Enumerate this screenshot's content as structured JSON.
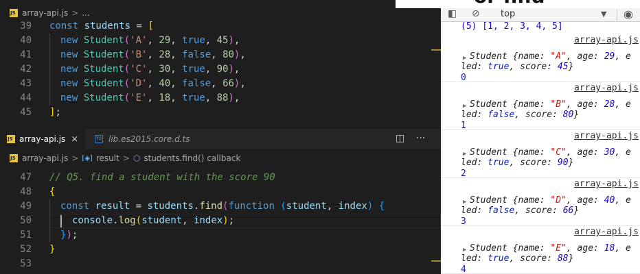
{
  "editor": {
    "top_breadcrumb": {
      "file": "array-api.js",
      "rest": "..."
    },
    "top_lines": [
      {
        "n": "39",
        "t": [
          [
            "kw",
            "const "
          ],
          [
            "var",
            "students"
          ],
          [
            "pl",
            " = "
          ],
          [
            "br1",
            "["
          ]
        ]
      },
      {
        "n": "40",
        "t": [
          [
            "kw",
            "new "
          ],
          [
            "cls",
            "Student"
          ],
          [
            "br2",
            "("
          ],
          [
            "str",
            "'A'"
          ],
          [
            "pl",
            ", "
          ],
          [
            "num",
            "29"
          ],
          [
            "pl",
            ", "
          ],
          [
            "kw",
            "true"
          ],
          [
            "pl",
            ", "
          ],
          [
            "num",
            "45"
          ],
          [
            "br2",
            ")"
          ],
          [
            "pl",
            ","
          ]
        ]
      },
      {
        "n": "41",
        "t": [
          [
            "kw",
            "new "
          ],
          [
            "cls",
            "Student"
          ],
          [
            "br2",
            "("
          ],
          [
            "str",
            "'B'"
          ],
          [
            "pl",
            ", "
          ],
          [
            "num",
            "28"
          ],
          [
            "pl",
            ", "
          ],
          [
            "kw",
            "false"
          ],
          [
            "pl",
            ", "
          ],
          [
            "num",
            "80"
          ],
          [
            "br2",
            ")"
          ],
          [
            "pl",
            ","
          ]
        ]
      },
      {
        "n": "42",
        "t": [
          [
            "kw",
            "new "
          ],
          [
            "cls",
            "Student"
          ],
          [
            "br2",
            "("
          ],
          [
            "str",
            "'C'"
          ],
          [
            "pl",
            ", "
          ],
          [
            "num",
            "30"
          ],
          [
            "pl",
            ", "
          ],
          [
            "kw",
            "true"
          ],
          [
            "pl",
            ", "
          ],
          [
            "num",
            "90"
          ],
          [
            "br2",
            ")"
          ],
          [
            "pl",
            ","
          ]
        ]
      },
      {
        "n": "43",
        "t": [
          [
            "kw",
            "new "
          ],
          [
            "cls",
            "Student"
          ],
          [
            "br2",
            "("
          ],
          [
            "str",
            "'D'"
          ],
          [
            "pl",
            ", "
          ],
          [
            "num",
            "40"
          ],
          [
            "pl",
            ", "
          ],
          [
            "kw",
            "false"
          ],
          [
            "pl",
            ", "
          ],
          [
            "num",
            "66"
          ],
          [
            "br2",
            ")"
          ],
          [
            "pl",
            ","
          ]
        ]
      },
      {
        "n": "44",
        "t": [
          [
            "kw",
            "new "
          ],
          [
            "cls",
            "Student"
          ],
          [
            "br2",
            "("
          ],
          [
            "str",
            "'E'"
          ],
          [
            "pl",
            ", "
          ],
          [
            "num",
            "18"
          ],
          [
            "pl",
            ", "
          ],
          [
            "kw",
            "true"
          ],
          [
            "pl",
            ", "
          ],
          [
            "num",
            "88"
          ],
          [
            "br2",
            ")"
          ],
          [
            "pl",
            ","
          ]
        ]
      },
      {
        "n": "45",
        "t": [
          [
            "br1",
            "]"
          ],
          [
            "pl",
            ";"
          ]
        ]
      }
    ],
    "tabs": [
      {
        "label": "array-api.js",
        "close": "×"
      },
      {
        "label": "lib.es2015.core.d.ts"
      }
    ],
    "tab_actions": {
      "split": "◫",
      "more": "···"
    },
    "breadcrumb": {
      "file": "array-api.js",
      "symbol1": "result",
      "symbol2": "students.find() callback"
    },
    "bottom_lines": [
      {
        "n": "47",
        "t": [
          [
            "cm",
            "// Q5. find a student with the score 90"
          ]
        ]
      },
      {
        "n": "48",
        "t": [
          [
            "br1",
            "{"
          ]
        ]
      },
      {
        "n": "49",
        "t": [
          [
            "kw",
            "const "
          ],
          [
            "var",
            "result"
          ],
          [
            "pl",
            " = "
          ],
          [
            "var",
            "students"
          ],
          [
            "pl",
            "."
          ],
          [
            "fn",
            "find"
          ],
          [
            "br2",
            "("
          ],
          [
            "kw",
            "function "
          ],
          [
            "br3",
            "("
          ],
          [
            "var",
            "student"
          ],
          [
            "pl",
            ", "
          ],
          [
            "var",
            "index"
          ],
          [
            "br3",
            ")"
          ],
          [
            "pl",
            " "
          ],
          [
            "br3",
            "{"
          ]
        ]
      },
      {
        "n": "50",
        "t": [
          [
            "var",
            "console"
          ],
          [
            "pl",
            "."
          ],
          [
            "fn",
            "log"
          ],
          [
            "br1",
            "("
          ],
          [
            "var",
            "student"
          ],
          [
            "pl",
            ", "
          ],
          [
            "var",
            "index"
          ],
          [
            "br1",
            ")"
          ],
          [
            "pl",
            ";"
          ]
        ]
      },
      {
        "n": "51",
        "t": [
          [
            "br3",
            "}"
          ],
          [
            "br2",
            ")"
          ],
          [
            "pl",
            ";"
          ]
        ]
      },
      {
        "n": "52",
        "t": [
          [
            "br1",
            "}"
          ]
        ]
      },
      {
        "n": "53",
        "t": []
      }
    ]
  },
  "devtools": {
    "title_overlay": "or find",
    "context": "top",
    "prev_output": "(5) [1, 2, 3, 4, 5]",
    "entries": [
      {
        "source": "array-api.js",
        "name": "A",
        "age": "29",
        "enrolled": "true",
        "score": "45",
        "index": "0"
      },
      {
        "source": "array-api.js",
        "name": "B",
        "age": "28",
        "enrolled": "false",
        "score": "80",
        "index": "1"
      },
      {
        "source": "array-api.js",
        "name": "C",
        "age": "30",
        "enrolled": "true",
        "score": "90",
        "index": "2"
      },
      {
        "source": "array-api.js",
        "name": "D",
        "age": "40",
        "enrolled": "false",
        "score": "66",
        "index": "3"
      },
      {
        "source": "array-api.js",
        "name": "E",
        "age": "18",
        "enrolled": "true",
        "score": "88",
        "index": "4"
      }
    ],
    "labels": {
      "cls": "Student",
      "name_key": "name",
      "age_key": "age",
      "enrolled_tail": "led",
      "enrolled_head": "e",
      "score_key": "score"
    }
  },
  "colors": {
    "editor_bg": "#1e1e1e",
    "keyword": "#569cd6",
    "string": "#ce9178",
    "number": "#b5cea8",
    "class": "#4ec9b0",
    "comment": "#6a9955"
  }
}
